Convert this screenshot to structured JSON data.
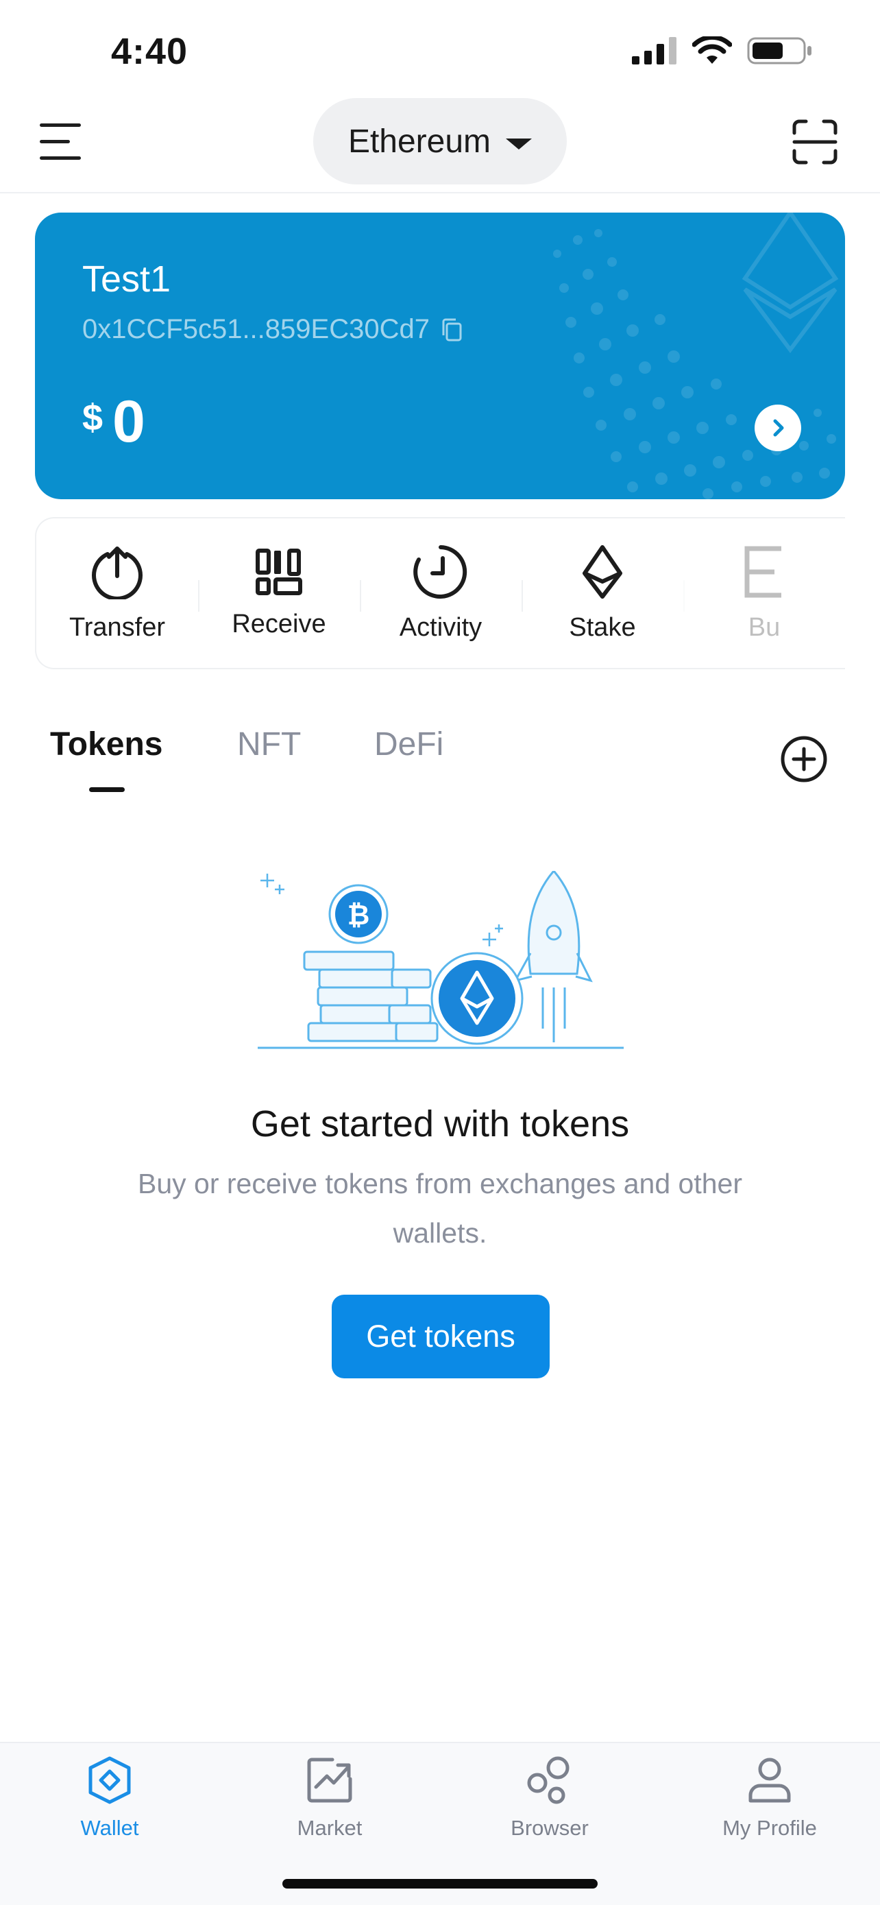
{
  "status_bar": {
    "time": "4:40"
  },
  "header": {
    "network": "Ethereum"
  },
  "wallet_card": {
    "name": "Test1",
    "address": "0x1CCF5c51...859EC30Cd7",
    "currency_symbol": "$",
    "balance": "0",
    "color": "#0a8fce"
  },
  "actions": [
    {
      "label": "Transfer",
      "icon": "upload-arrow-icon"
    },
    {
      "label": "Receive",
      "icon": "qr-code-icon"
    },
    {
      "label": "Activity",
      "icon": "clock-icon"
    },
    {
      "label": "Stake",
      "icon": "ethereum-diamond-icon"
    },
    {
      "label": "Bu",
      "icon": "buy-icon"
    }
  ],
  "tabs": [
    {
      "label": "Tokens",
      "active": true
    },
    {
      "label": "NFT",
      "active": false
    },
    {
      "label": "DeFi",
      "active": false
    }
  ],
  "empty_state": {
    "title": "Get started with tokens",
    "description": "Buy or receive tokens from exchanges and other wallets.",
    "button": "Get tokens"
  },
  "bottom_nav": [
    {
      "label": "Wallet",
      "icon": "wallet-hexagon-icon",
      "active": true
    },
    {
      "label": "Market",
      "icon": "chart-icon",
      "active": false
    },
    {
      "label": "Browser",
      "icon": "browser-circles-icon",
      "active": false
    },
    {
      "label": "My Profile",
      "icon": "person-icon",
      "active": false
    }
  ],
  "colors": {
    "accent": "#0b8ae6",
    "active_nav": "#1a8ee6",
    "muted_text": "#8a8f9c"
  }
}
